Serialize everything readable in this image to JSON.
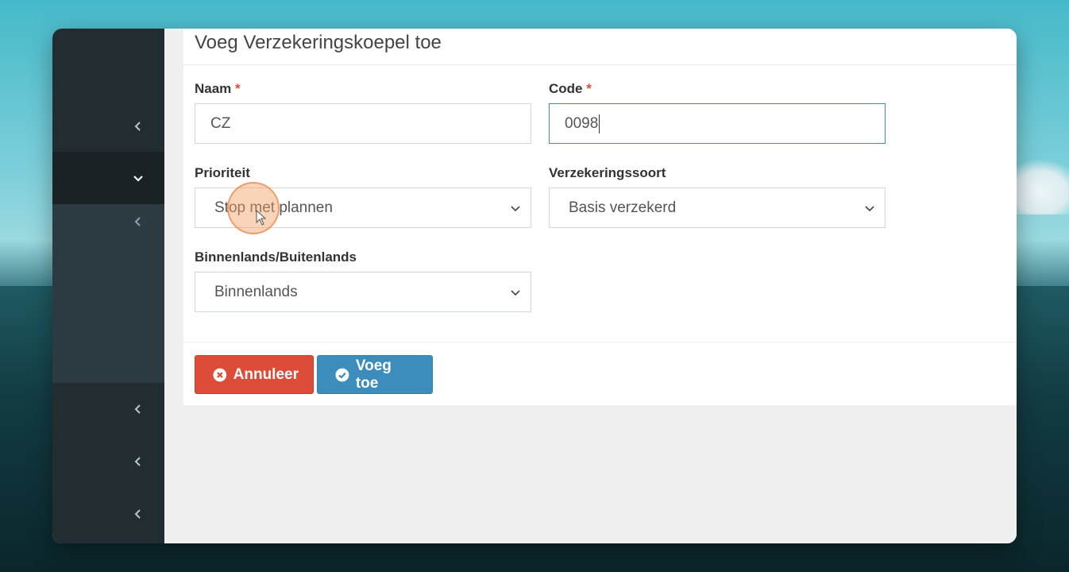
{
  "form": {
    "title": "Voeg Verzekeringskoepel toe",
    "required_marker": "*",
    "naam": {
      "label": "Naam",
      "value": "CZ"
    },
    "code": {
      "label": "Code",
      "value": "0098"
    },
    "prioriteit": {
      "label": "Prioriteit",
      "selected": "Stop met plannen"
    },
    "verzekeringssoort": {
      "label": "Verzekeringssoort",
      "selected": "Basis verzekerd"
    },
    "binnenlands": {
      "label": "Binnenlands/Buitenlands",
      "selected": "Binnenlands"
    }
  },
  "actions": {
    "cancel_label": "Annuleer",
    "submit_label": "Voeg toe"
  },
  "sidebar": {
    "items": [
      {
        "icon": "chevron-left-icon",
        "state": "collapsed"
      },
      {
        "icon": "chevron-down-icon",
        "state": "expanded"
      },
      {
        "icon": "chevron-left-icon",
        "state": "collapsed"
      },
      {
        "icon": "chevron-left-icon",
        "state": "collapsed"
      },
      {
        "icon": "chevron-left-icon",
        "state": "collapsed"
      },
      {
        "icon": "chevron-left-icon",
        "state": "collapsed"
      }
    ]
  },
  "colors": {
    "danger": "#dd4b39",
    "primary": "#3c8dbc",
    "sidebar": "#222d32",
    "focus_border": "#3c8dbc"
  }
}
